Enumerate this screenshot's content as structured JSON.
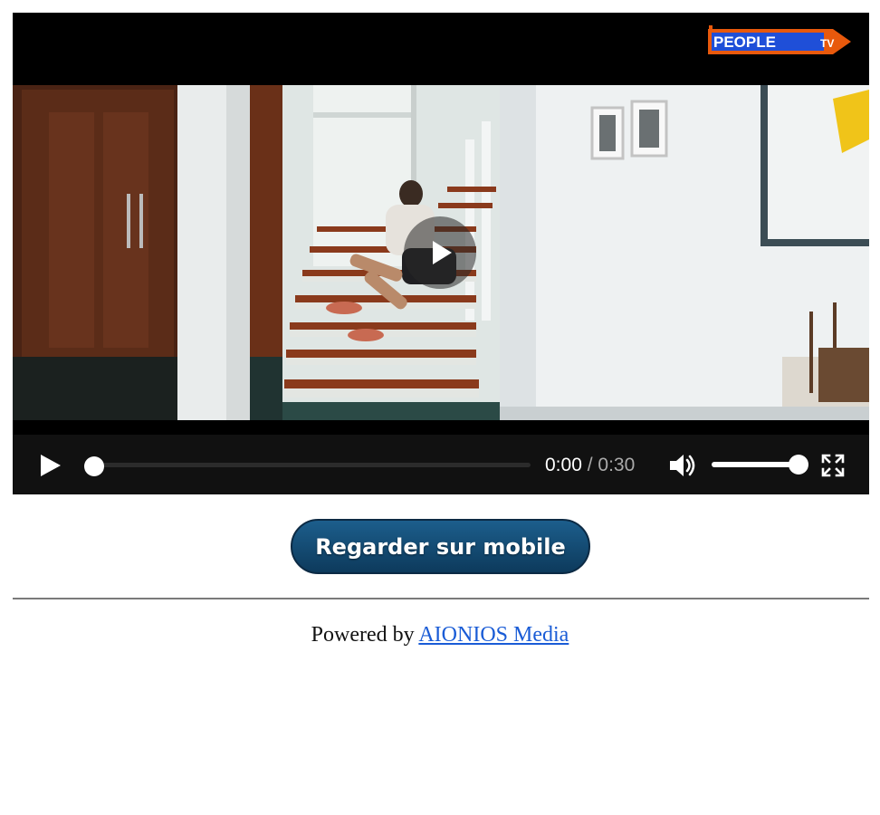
{
  "player": {
    "logo_text": "PEOPLE",
    "logo_badge": "TV",
    "big_play_icon": "play-icon",
    "controls": {
      "play_icon": "play-icon",
      "current_time": "0:00",
      "separator": "/",
      "duration": "0:30",
      "progress": 0.0,
      "volume_icon": "volume-icon",
      "volume_level": 1.0,
      "fullscreen_icon": "fullscreen-icon"
    },
    "colors": {
      "controls_bg": "#111111",
      "logo_orange": "#e8590c",
      "logo_blue": "#1f4fd8"
    }
  },
  "mobile_button": {
    "label": "Regarder sur mobile",
    "color": "#134b75"
  },
  "footer": {
    "powered_by": "Powered by",
    "link_text": "AIONIOS Media",
    "link_color": "#1a5cd6"
  }
}
